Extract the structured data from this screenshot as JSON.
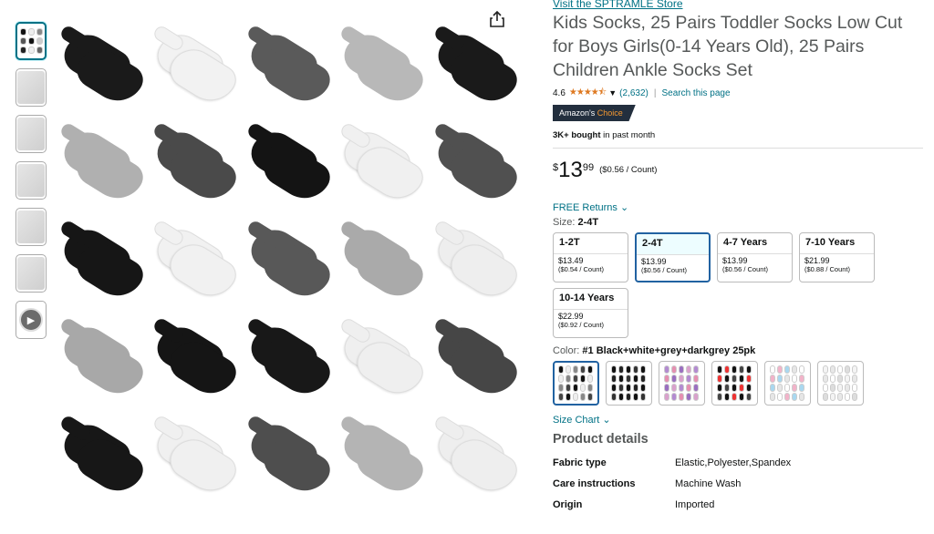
{
  "thumbnails": [
    {
      "name": "thumb-1",
      "kind": "grid",
      "selected": true
    },
    {
      "name": "thumb-2",
      "kind": "scene"
    },
    {
      "name": "thumb-3",
      "kind": "scene"
    },
    {
      "name": "thumb-4",
      "kind": "scene"
    },
    {
      "name": "thumb-5",
      "kind": "scene"
    },
    {
      "name": "thumb-6",
      "kind": "scene"
    },
    {
      "name": "thumb-video",
      "kind": "video",
      "icon": "play-icon"
    }
  ],
  "main_image": {
    "share_icon": "share-icon",
    "sock_colors": [
      "#1a1a1a",
      "#f2f2f2",
      "#5a5a5a",
      "#b8b8b8",
      "#1a1a1a",
      "#b0b0b0",
      "#4a4a4a",
      "#141414",
      "#f0f0f0",
      "#505050",
      "#161616",
      "#f1f1f1",
      "#585858",
      "#aaaaaa",
      "#eeeeee",
      "#a8a8a8",
      "#151515",
      "#181818",
      "#efefef",
      "#464646",
      "#171717",
      "#f0f0f0",
      "#4e4e4e",
      "#b4b4b4",
      "#eeeeee"
    ]
  },
  "product": {
    "store_link": "Visit the SPTRAMLE Store",
    "title": "Kids Socks, 25 Pairs Toddler Socks Low Cut for Boys Girls(0-14 Years Old), 25 Pairs Children Ankle Socks Set",
    "rating_value": "4.6",
    "stars": "★★★★⯪",
    "rating_count": "(2,632)",
    "search_page": "Search this page",
    "badge_prefix": "Amazon's",
    "badge_suffix": "Choice",
    "bought_bold": "3K+ bought",
    "bought_rest": " in past month",
    "price_symbol": "$",
    "price_whole": "13",
    "price_fraction": "99",
    "price_unit": "($0.56 / Count)",
    "free_returns": "FREE Returns",
    "size_label": "Size: ",
    "size_value": "2-4T",
    "size_options": [
      {
        "label": "1-2T",
        "price": "$13.49",
        "unit": "($0.54 / Count)",
        "selected": false
      },
      {
        "label": "2-4T",
        "price": "$13.99",
        "unit": "($0.56 / Count)",
        "selected": true
      },
      {
        "label": "4-7 Years",
        "price": "$13.99",
        "unit": "($0.56 / Count)",
        "selected": false
      },
      {
        "label": "7-10 Years",
        "price": "$21.99",
        "unit": "($0.88 / Count)",
        "selected": false
      },
      {
        "label": "10-14 Years",
        "price": "$22.99",
        "unit": "($0.92 / Count)",
        "selected": false
      }
    ],
    "color_label": "Color: ",
    "color_value": "#1 Black+white+grey+darkgrey 25pk",
    "color_swatches": [
      {
        "palette": [
          "#111",
          "#eee",
          "#888",
          "#444"
        ],
        "selected": true
      },
      {
        "palette": [
          "#111",
          "#222",
          "#111",
          "#333"
        ],
        "selected": false
      },
      {
        "palette": [
          "#b38bd1",
          "#e58fb1",
          "#9a6fc0",
          "#d9a1cc"
        ],
        "selected": false
      },
      {
        "palette": [
          "#111",
          "#e33",
          "#111",
          "#444"
        ],
        "selected": false
      },
      {
        "palette": [
          "#fff",
          "#f2b3c9",
          "#a9d8f0",
          "#e6e6e6"
        ],
        "selected": false
      },
      {
        "palette": [
          "#f4f4f4",
          "#e8e8e8",
          "#ffffff",
          "#dddddd"
        ],
        "selected": false
      }
    ],
    "size_chart": "Size Chart",
    "details_title": "Product details",
    "details": [
      {
        "k": "Fabric type",
        "v": "Elastic,Polyester,Spandex"
      },
      {
        "k": "Care instructions",
        "v": "Machine Wash"
      },
      {
        "k": "Origin",
        "v": "Imported"
      }
    ]
  }
}
